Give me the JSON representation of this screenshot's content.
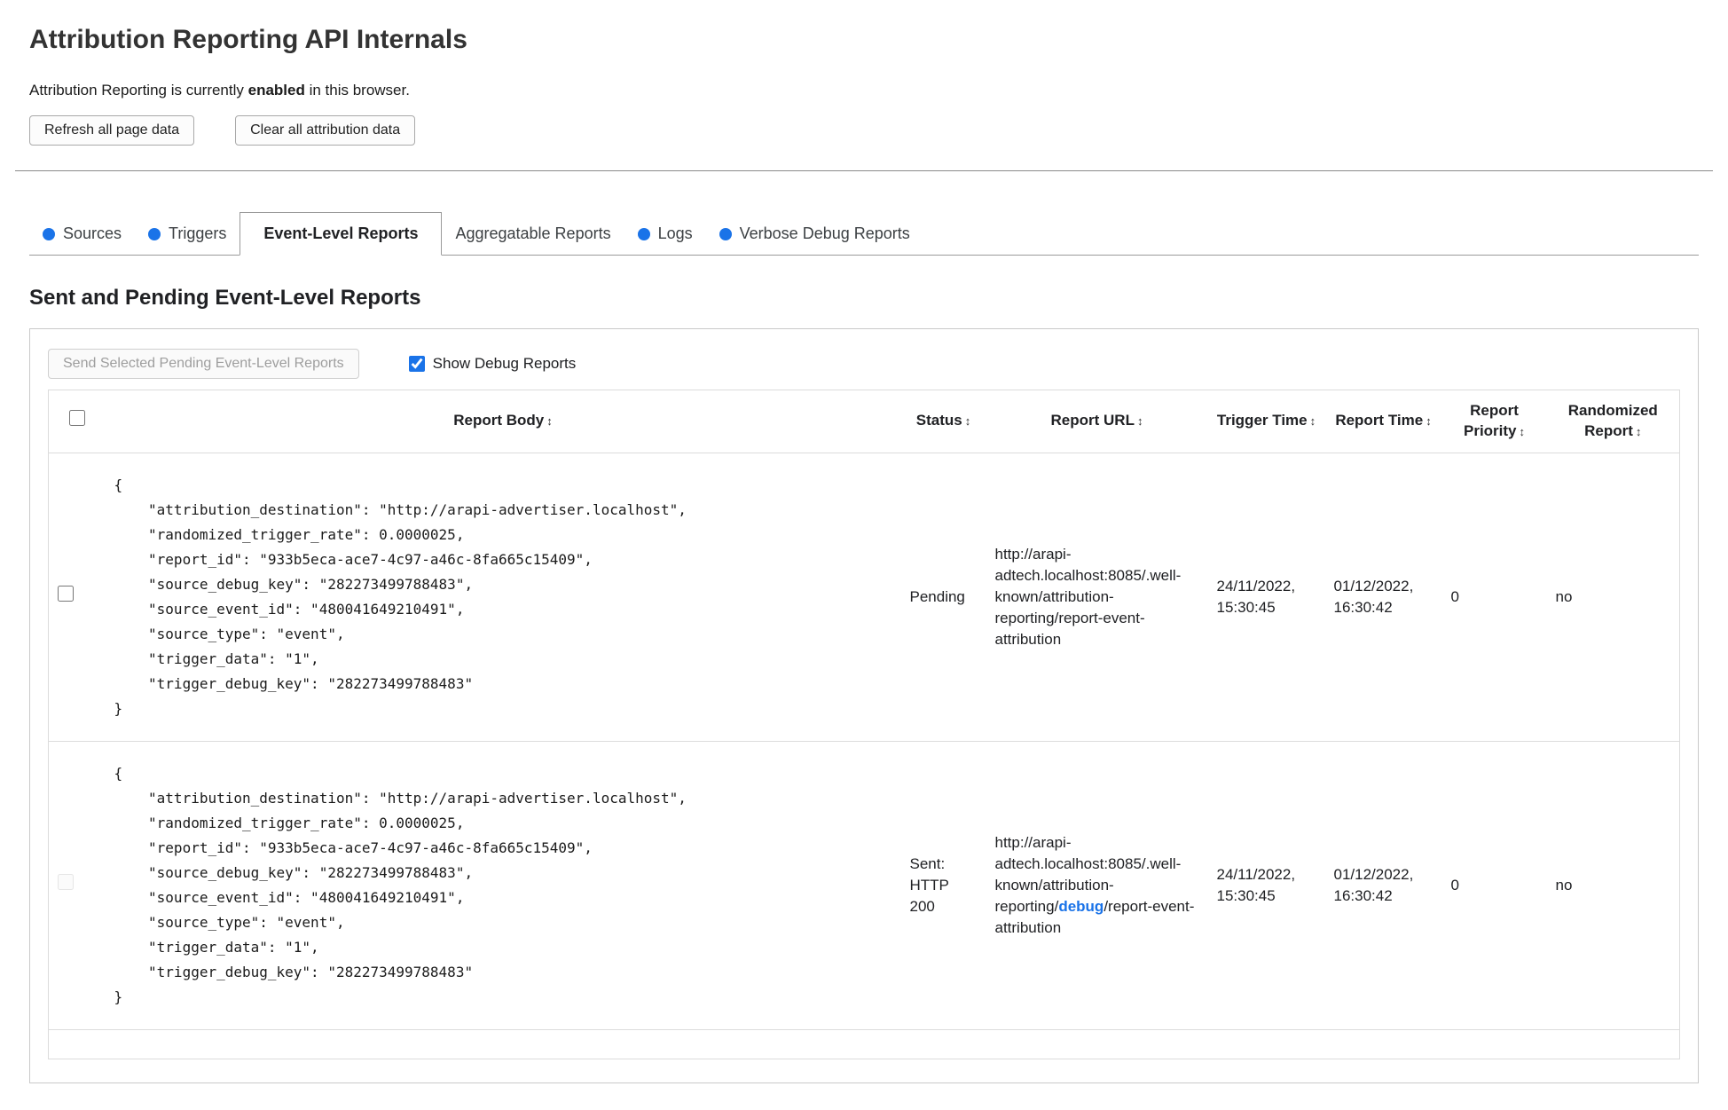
{
  "page": {
    "title": "Attribution Reporting API Internals",
    "status_prefix": "Attribution Reporting is currently ",
    "status_bold": "enabled",
    "status_suffix": " in this browser."
  },
  "toolbar": {
    "refresh_label": "Refresh all page data",
    "clear_label": "Clear all attribution data"
  },
  "tabs": [
    {
      "label": "Sources",
      "has_dot": true,
      "active": false
    },
    {
      "label": "Triggers",
      "has_dot": true,
      "active": false
    },
    {
      "label": "Event-Level Reports",
      "has_dot": false,
      "active": true
    },
    {
      "label": "Aggregatable Reports",
      "has_dot": false,
      "active": false
    },
    {
      "label": "Logs",
      "has_dot": true,
      "active": false
    },
    {
      "label": "Verbose Debug Reports",
      "has_dot": true,
      "active": false
    }
  ],
  "section": {
    "heading": "Sent and Pending Event-Level Reports",
    "send_button_label": "Send Selected Pending Event-Level Reports",
    "send_button_disabled": true,
    "show_debug_label": "Show Debug Reports",
    "show_debug_checked": true
  },
  "icons": {
    "sort_arrows": "↕"
  },
  "colors": {
    "accent_blue": "#1a73e8"
  },
  "table": {
    "headers": [
      "Report Body",
      "Status",
      "Report URL",
      "Trigger Time",
      "Report Time",
      "Report Priority",
      "Randomized Report"
    ],
    "rows": [
      {
        "checkbox_disabled": false,
        "report_body": "{\n    \"attribution_destination\": \"http://arapi-advertiser.localhost\",\n    \"randomized_trigger_rate\": 0.0000025,\n    \"report_id\": \"933b5eca-ace7-4c97-a46c-8fa665c15409\",\n    \"source_debug_key\": \"282273499788483\",\n    \"source_event_id\": \"480041649210491\",\n    \"source_type\": \"event\",\n    \"trigger_data\": \"1\",\n    \"trigger_debug_key\": \"282273499788483\"\n}",
        "status": "Pending",
        "report_url": {
          "prefix": "http://arapi-adtech.localhost:8085/.well-known/attribution-reporting/report-event-attribution",
          "link": "",
          "suffix": ""
        },
        "trigger_time": "24/11/2022, 15:30:45",
        "report_time": "01/12/2022, 16:30:42",
        "report_priority": "0",
        "randomized_report": "no"
      },
      {
        "checkbox_disabled": true,
        "report_body": "{\n    \"attribution_destination\": \"http://arapi-advertiser.localhost\",\n    \"randomized_trigger_rate\": 0.0000025,\n    \"report_id\": \"933b5eca-ace7-4c97-a46c-8fa665c15409\",\n    \"source_debug_key\": \"282273499788483\",\n    \"source_event_id\": \"480041649210491\",\n    \"source_type\": \"event\",\n    \"trigger_data\": \"1\",\n    \"trigger_debug_key\": \"282273499788483\"\n}",
        "status": "Sent: HTTP 200",
        "report_url": {
          "prefix": "http://arapi-adtech.localhost:8085/.well-known/attribution-reporting/",
          "link": "debug",
          "suffix": "/report-event-attribution"
        },
        "trigger_time": "24/11/2022, 15:30:45",
        "report_time": "01/12/2022, 16:30:42",
        "report_priority": "0",
        "randomized_report": "no"
      }
    ]
  }
}
